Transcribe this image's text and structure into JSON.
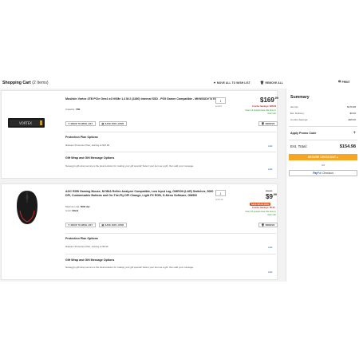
{
  "header": {
    "title": "Shopping Cart",
    "count": "(2 Items)",
    "move_all_label": "MOVE ALL TO WISH LIST",
    "remove_all_label": "REMOVE ALL",
    "print_label": "PRINT"
  },
  "items": [
    {
      "name": "Mushkin Vortex 4TB PCIe Gen4 x4 NVMe 1.4 M.2 (2280) Internal SSD - PS5 Gamer Compatible - MKNSSDVT4TB-D8",
      "spec_label": "Capacity:",
      "spec_value": "4TB",
      "qty": "1",
      "limit": "Limit 5",
      "price_whole": "$169",
      "price_cents": ".99",
      "save_text": "Combo Savings: $28.50",
      "people_text": "Over 14 people have this item in their cart",
      "move_label": "MOVE TO WISH LIST",
      "save_later_label": "SAVE FOR LATER",
      "remove_label": "REMOVE",
      "protection_title": "Protection Plan Options",
      "protection_text": "Rakuten Protection Plan, starting at $22.99",
      "protection_price": "$22.99",
      "add_label": "Add",
      "gift_title": "Gift Wrap and Gift Message Options",
      "gift_text": "Newegg's gift-wrap service is the ideal solution for making your gift special! Select your item as a gift, then add your message.",
      "gift_add": "Add"
    },
    {
      "name": "AOC RGB Gaming Mouse, NVIDIA Reflex Analyzer Compatible, Low Input Lag, OMRON (L&R) Switches, 5000 DPI, Customizable Buttons and On-The-Fly DPI Change, Light FX RGB, G-Menu Software, GM500",
      "spec1_label": "Maximum dpi:",
      "spec1_value": "5000 dpi",
      "spec2_label": "Color:",
      "spec2_value": "Black",
      "qty": "1",
      "limit": "Limit 10",
      "was_price": "$24.99",
      "deal_badge": "SAVE $15.00 (60%)",
      "price_whole": "$9",
      "price_cents": ".99",
      "save_text": "Combo Savings: $5.00",
      "people_text": "Over 10 people have this item in their cart",
      "move_label": "MOVE TO WISH LIST",
      "save_later_label": "SAVE FOR LATER",
      "remove_label": "REMOVE",
      "protection_title": "Protection Plan Options",
      "protection_text": "Rakuten Protection Plan, starting at $6.99",
      "protection_price": "$6.99",
      "add_label": "Add",
      "gift_title": "Gift Wrap and Gift Message Options",
      "gift_text": "Newegg's gift-wrap service is the ideal solution for making your gift special! Select your item as a gift, then add your message.",
      "gift_add": "Add"
    }
  ],
  "summary": {
    "title": "Summary",
    "rows": [
      {
        "label": "Item(s):",
        "value": "$179.98"
      },
      {
        "label": "Est. Delivery:",
        "value": "$0.00"
      },
      {
        "label": "Combo Savings:",
        "value": "-$25.00"
      }
    ],
    "promo_label": "Apply Promo Code",
    "est_label": "Est. Total:",
    "est_value": "$154.98",
    "secure_label": "SECURE CHECKOUT ▸",
    "or_label": "OR",
    "paypal_pay": "Pay",
    "paypal_pal": "Pal",
    "paypal_checkout": "Checkout"
  },
  "colors": {
    "accent_orange": "#f7a623",
    "savings_red": "#c4262e",
    "people_green": "#1d8f1d",
    "link_blue": "#1a5cc8"
  }
}
